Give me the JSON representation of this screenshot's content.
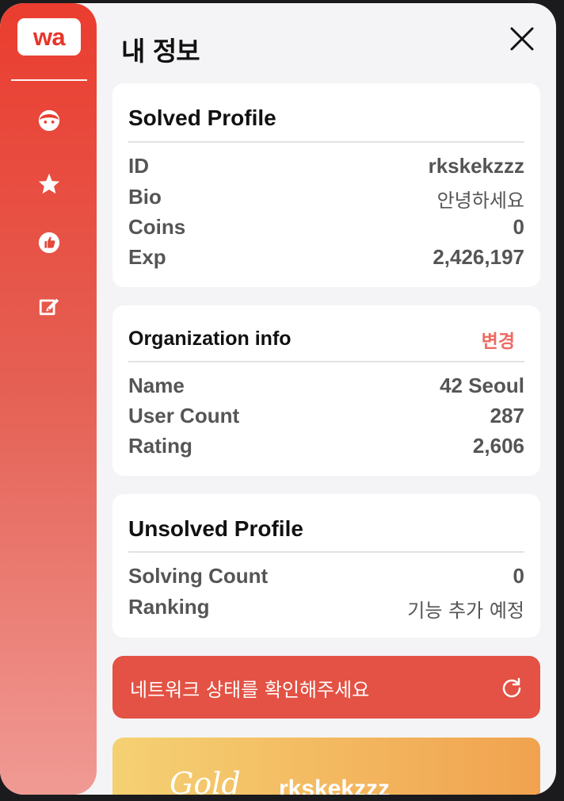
{
  "window": {
    "title": "내 정보"
  },
  "sidebar": {
    "logo": "wa",
    "items": [
      {
        "icon": "face-icon"
      },
      {
        "icon": "star-icon"
      },
      {
        "icon": "thumbs-up-icon"
      },
      {
        "icon": "edit-icon"
      }
    ]
  },
  "solved_profile": {
    "title": "Solved Profile",
    "rows": [
      {
        "label": "ID",
        "value": "rkskekzzz"
      },
      {
        "label": "Bio",
        "value": "안녕하세요"
      },
      {
        "label": "Coins",
        "value": "0"
      },
      {
        "label": "Exp",
        "value": "2,426,197"
      }
    ]
  },
  "organization": {
    "title": "Organization info",
    "action": "변경",
    "rows": [
      {
        "label": "Name",
        "value": "42 Seoul"
      },
      {
        "label": "User Count",
        "value": "287"
      },
      {
        "label": "Rating",
        "value": "2,606"
      }
    ]
  },
  "unsolved_profile": {
    "title": "Unsolved Profile",
    "rows": [
      {
        "label": "Solving Count",
        "value": "0"
      },
      {
        "label": "Ranking",
        "value": "기능 추가 예정"
      }
    ]
  },
  "network_banner": {
    "text": "네트워크 상태를 확인해주세요"
  },
  "tier_card": {
    "tier": "Gold",
    "username": "rkskekzzz"
  },
  "colors": {
    "accent": "#e8352a",
    "banner": "#e35244",
    "action": "#ee6a62"
  }
}
